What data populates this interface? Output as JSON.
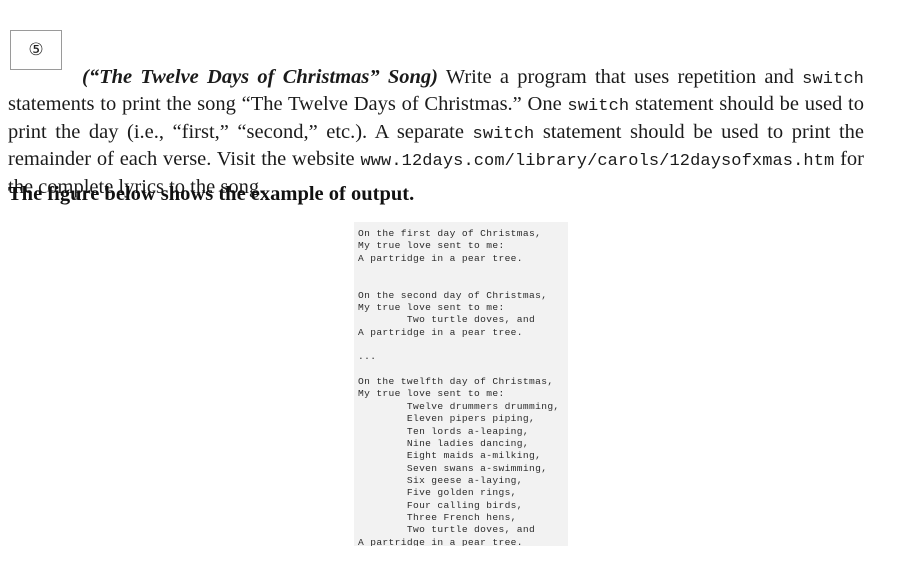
{
  "exercise": {
    "number_glyph": "⑤",
    "number": "5"
  },
  "problem": {
    "title": "(“The Twelve Days of Christmas” Song)",
    "segment_1": " Write a program that uses repetition and ",
    "keyword_1": "switch",
    "segment_2": " statements to print the song “The Twelve Days of Christmas.” One ",
    "keyword_2": "switch",
    "segment_3": " statement should be used to print the day (i.e., “first,” “second,” etc.). A separate ",
    "keyword_3": "switch",
    "segment_4": " statement should be used to print the remainder of each verse. Visit the website ",
    "url": "www.12days.com/library/carols/12daysofxmas.htm",
    "segment_5": " for the complete lyrics to the song."
  },
  "figure_caption": "The figure below shows the example of output.",
  "output": {
    "background_color": "#f2f2f2",
    "lines": [
      "On the first day of Christmas,",
      "My true love sent to me:",
      "A partridge in a pear tree.",
      "",
      "",
      "On the second day of Christmas,",
      "My true love sent to me:",
      "        Two turtle doves, and",
      "A partridge in a pear tree.",
      "",
      "...",
      "",
      "On the twelfth day of Christmas,",
      "My true love sent to me:",
      "        Twelve drummers drumming,",
      "        Eleven pipers piping,",
      "        Ten lords a-leaping,",
      "        Nine ladies dancing,",
      "        Eight maids a-milking,",
      "        Seven swans a-swimming,",
      "        Six geese a-laying,",
      "        Five golden rings,",
      "        Four calling birds,",
      "        Three French hens,",
      "        Two turtle doves, and",
      "A partridge in a pear tree."
    ]
  }
}
